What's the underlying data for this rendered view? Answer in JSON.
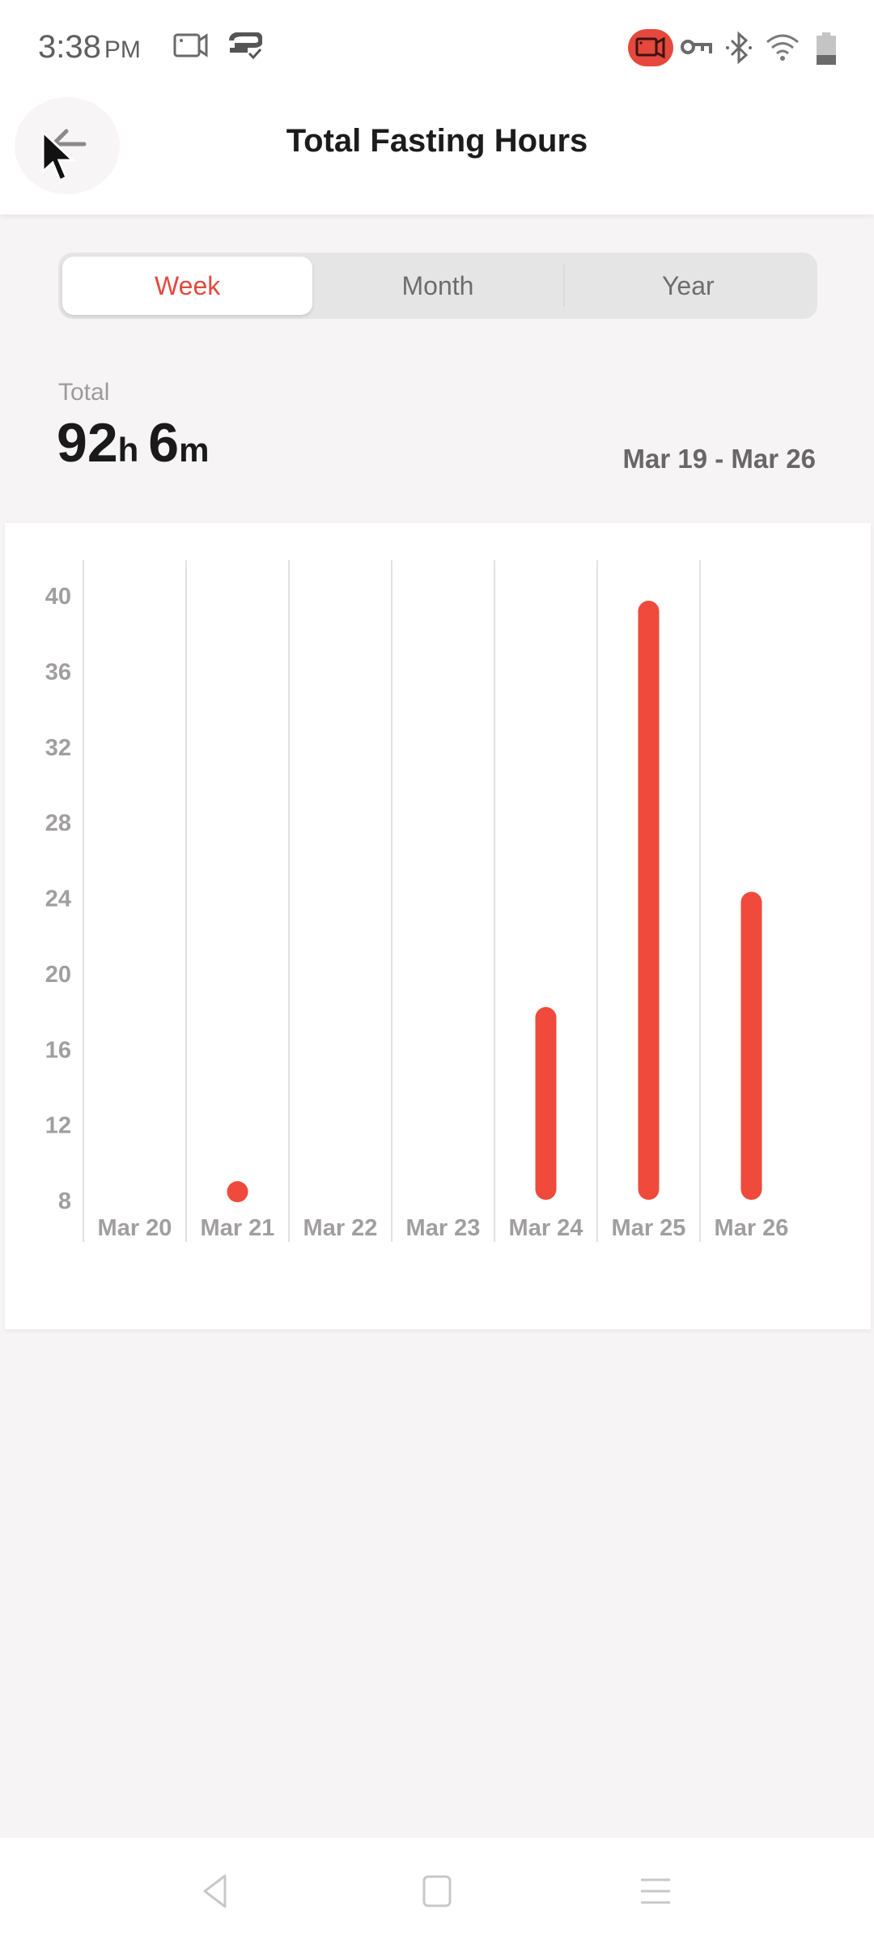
{
  "status_bar": {
    "time": "3:38",
    "ampm": "PM",
    "icons": [
      "screen-record-icon",
      "vpn-app-icon",
      "recording-active-icon",
      "vpn-key-icon",
      "bluetooth-icon",
      "wifi-icon",
      "battery-icon"
    ],
    "record_color": "#e5483c"
  },
  "header": {
    "title": "Total Fasting Hours",
    "back_icon": "arrow-left-icon"
  },
  "tabs": [
    {
      "label": "Week",
      "active": true
    },
    {
      "label": "Month",
      "active": false
    },
    {
      "label": "Year",
      "active": false
    }
  ],
  "summary": {
    "label": "Total",
    "hours": "92",
    "hours_unit": "h",
    "minutes": "6",
    "minutes_unit": "m",
    "date_range": "Mar 19 - Mar 26"
  },
  "chart_data": {
    "type": "bar",
    "title": "",
    "xlabel": "",
    "ylabel": "",
    "categories": [
      "Mar 20",
      "Mar 21",
      "Mar 22",
      "Mar 23",
      "Mar 24",
      "Mar 25",
      "Mar 26"
    ],
    "values": [
      null,
      8.5,
      null,
      null,
      18.2,
      39.7,
      24.3
    ],
    "ylim": [
      8,
      40
    ],
    "yticks": [
      40,
      36,
      32,
      28,
      24,
      20,
      16,
      12,
      8
    ],
    "grid": "vertical",
    "bar_color": "#ef4a3c",
    "legend": "none"
  },
  "nav_bar": {
    "buttons": [
      "back-triangle-icon",
      "home-square-icon",
      "menu-lines-icon"
    ]
  }
}
